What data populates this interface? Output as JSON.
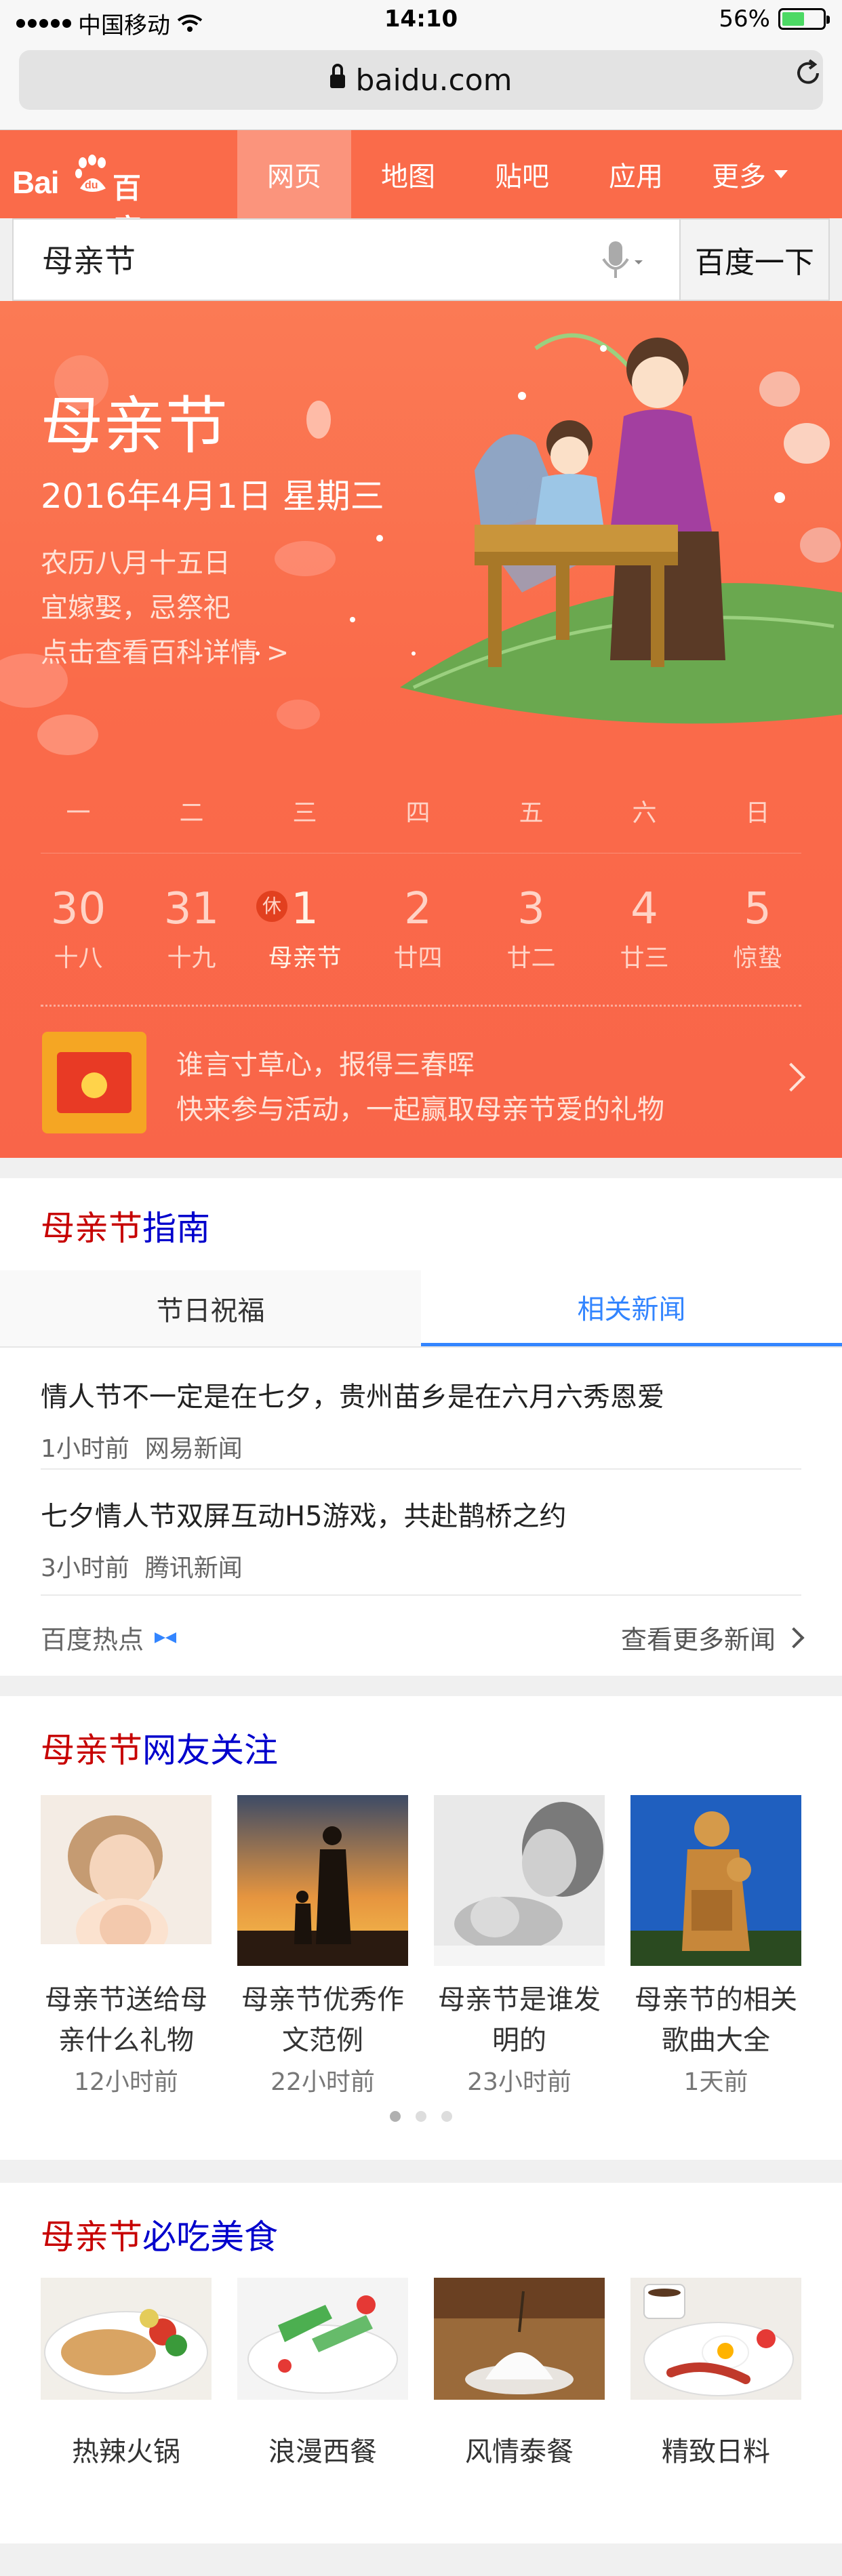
{
  "status_bar": {
    "carrier": "中国移动",
    "time": "14:10",
    "battery": "56%",
    "battery_level": 0.56
  },
  "address_bar": {
    "url": "baidu.com"
  },
  "header": {
    "logo_text": "Bai",
    "logo_du": "du",
    "logo_cn": "百度",
    "nav": [
      "网页",
      "地图",
      "贴吧",
      "应用",
      "更多"
    ],
    "active_nav": 0
  },
  "search": {
    "query": "母亲节",
    "button": "百度一下"
  },
  "hero": {
    "title": "母亲节",
    "date": "2016年4月1日 星期三",
    "lunar": "农历八月十五日",
    "yiji": "宜嫁娶，忌祭祀",
    "link": "点击查看百科详情 >",
    "weekdays": [
      "一",
      "二",
      "三",
      "四",
      "五",
      "六",
      "日"
    ],
    "days": [
      {
        "num": "30",
        "sub": "十八"
      },
      {
        "num": "31",
        "sub": "十九"
      },
      {
        "num": "1",
        "sub": "母亲节",
        "badge": "休"
      },
      {
        "num": "2",
        "sub": "廿四"
      },
      {
        "num": "3",
        "sub": "廿二"
      },
      {
        "num": "4",
        "sub": "廿三"
      },
      {
        "num": "5",
        "sub": "惊蛰"
      }
    ],
    "promo_line1": "谁言寸草心，报得三春晖",
    "promo_line2": "快来参与活动，一起赢取母亲节爱的礼物"
  },
  "guide": {
    "title_red": "母亲节",
    "title_blue": "指南",
    "tabs": [
      "节日祝福",
      "相关新闻"
    ],
    "active_tab": 1,
    "news": [
      {
        "title": "情人节不一定是在七夕，贵州苗乡是在六月六秀恩爱",
        "time": "1小时前",
        "source": "网易新闻"
      },
      {
        "title": "七夕情人节双屏互动H5游戏，共赴鹊桥之约",
        "time": "3小时前",
        "source": "腾讯新闻"
      }
    ],
    "footer_left": "百度热点",
    "footer_right": "查看更多新闻"
  },
  "netizen": {
    "title_red": "母亲节",
    "title_blue": "网友关注",
    "items": [
      {
        "line1": "母亲节送给母",
        "line2": "亲什么礼物",
        "time": "12小时前"
      },
      {
        "line1": "母亲节优秀作",
        "line2": "文范例",
        "time": "22小时前"
      },
      {
        "line1": "母亲节是谁发",
        "line2": "明的",
        "time": "23小时前"
      },
      {
        "line1": "母亲节的相关",
        "line2": "歌曲大全",
        "time": "1天前"
      }
    ]
  },
  "food": {
    "title_red": "母亲节",
    "title_blue": "必吃美食",
    "items": [
      "热辣火锅",
      "浪漫西餐",
      "风情泰餐",
      "精致日料"
    ]
  },
  "colors": {
    "brand": "#fa6b4a",
    "link_blue": "#3385ff",
    "title_red": "#c70000",
    "title_blue": "#0000cc"
  }
}
